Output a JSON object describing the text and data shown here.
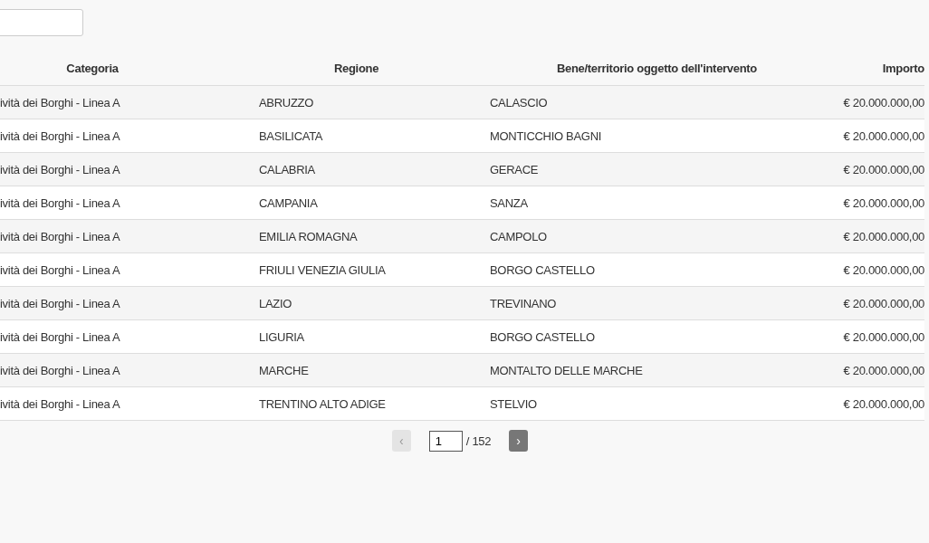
{
  "table": {
    "columns": [
      "Categoria",
      "Regione",
      "Bene/territorio oggetto dell'intervento",
      "Importo"
    ],
    "rows": [
      [
        "ività dei Borghi - Linea A",
        "ABRUZZO",
        "CALASCIO",
        "€ 20.000.000,00"
      ],
      [
        "ività dei Borghi - Linea A",
        "BASILICATA",
        "MONTICCHIO BAGNI",
        "€ 20.000.000,00"
      ],
      [
        "ività dei Borghi - Linea A",
        "CALABRIA",
        "GERACE",
        "€ 20.000.000,00"
      ],
      [
        "ività dei Borghi - Linea A",
        "CAMPANIA",
        "SANZA",
        "€ 20.000.000,00"
      ],
      [
        "ività dei Borghi - Linea A",
        "EMILIA ROMAGNA",
        "CAMPOLO",
        "€ 20.000.000,00"
      ],
      [
        "ività dei Borghi - Linea A",
        "FRIULI VENEZIA GIULIA",
        "BORGO CASTELLO",
        "€ 20.000.000,00"
      ],
      [
        "ività dei Borghi - Linea A",
        "LAZIO",
        "TREVINANO",
        "€ 20.000.000,00"
      ],
      [
        "ività dei Borghi - Linea A",
        "LIGURIA",
        "BORGO CASTELLO",
        "€ 20.000.000,00"
      ],
      [
        "ività dei Borghi - Linea A",
        "MARCHE",
        "MONTALTO DELLE MARCHE",
        "€ 20.000.000,00"
      ],
      [
        "ività dei Borghi - Linea A",
        "TRENTINO ALTO ADIGE",
        "STELVIO",
        "€ 20.000.000,00"
      ]
    ]
  },
  "pagination": {
    "prev": {
      "label": "‹",
      "disabled": true
    },
    "page": "1",
    "total": "/ 152",
    "next": {
      "label": "›",
      "disabled": false
    }
  }
}
